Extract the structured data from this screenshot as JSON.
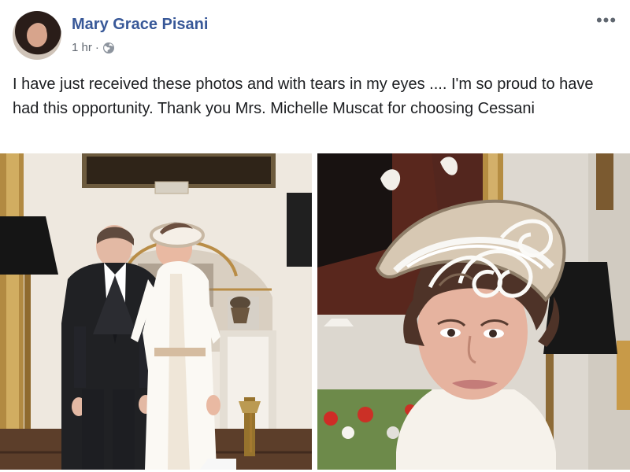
{
  "post": {
    "author": "Mary Grace Pisani",
    "timestamp": "1 hr",
    "privacy_icon": "globe-icon",
    "more_icon": "ellipsis-icon",
    "message": "I have just received these photos and with tears in my eyes .... I'm so proud to have had this opportunity. Thank you Mrs. Michelle Muscat for choosing Cessani"
  },
  "colors": {
    "author_link": "#385898",
    "secondary_text": "#606770",
    "body_text": "#1c1e21"
  },
  "meta": {
    "separator": "·"
  }
}
